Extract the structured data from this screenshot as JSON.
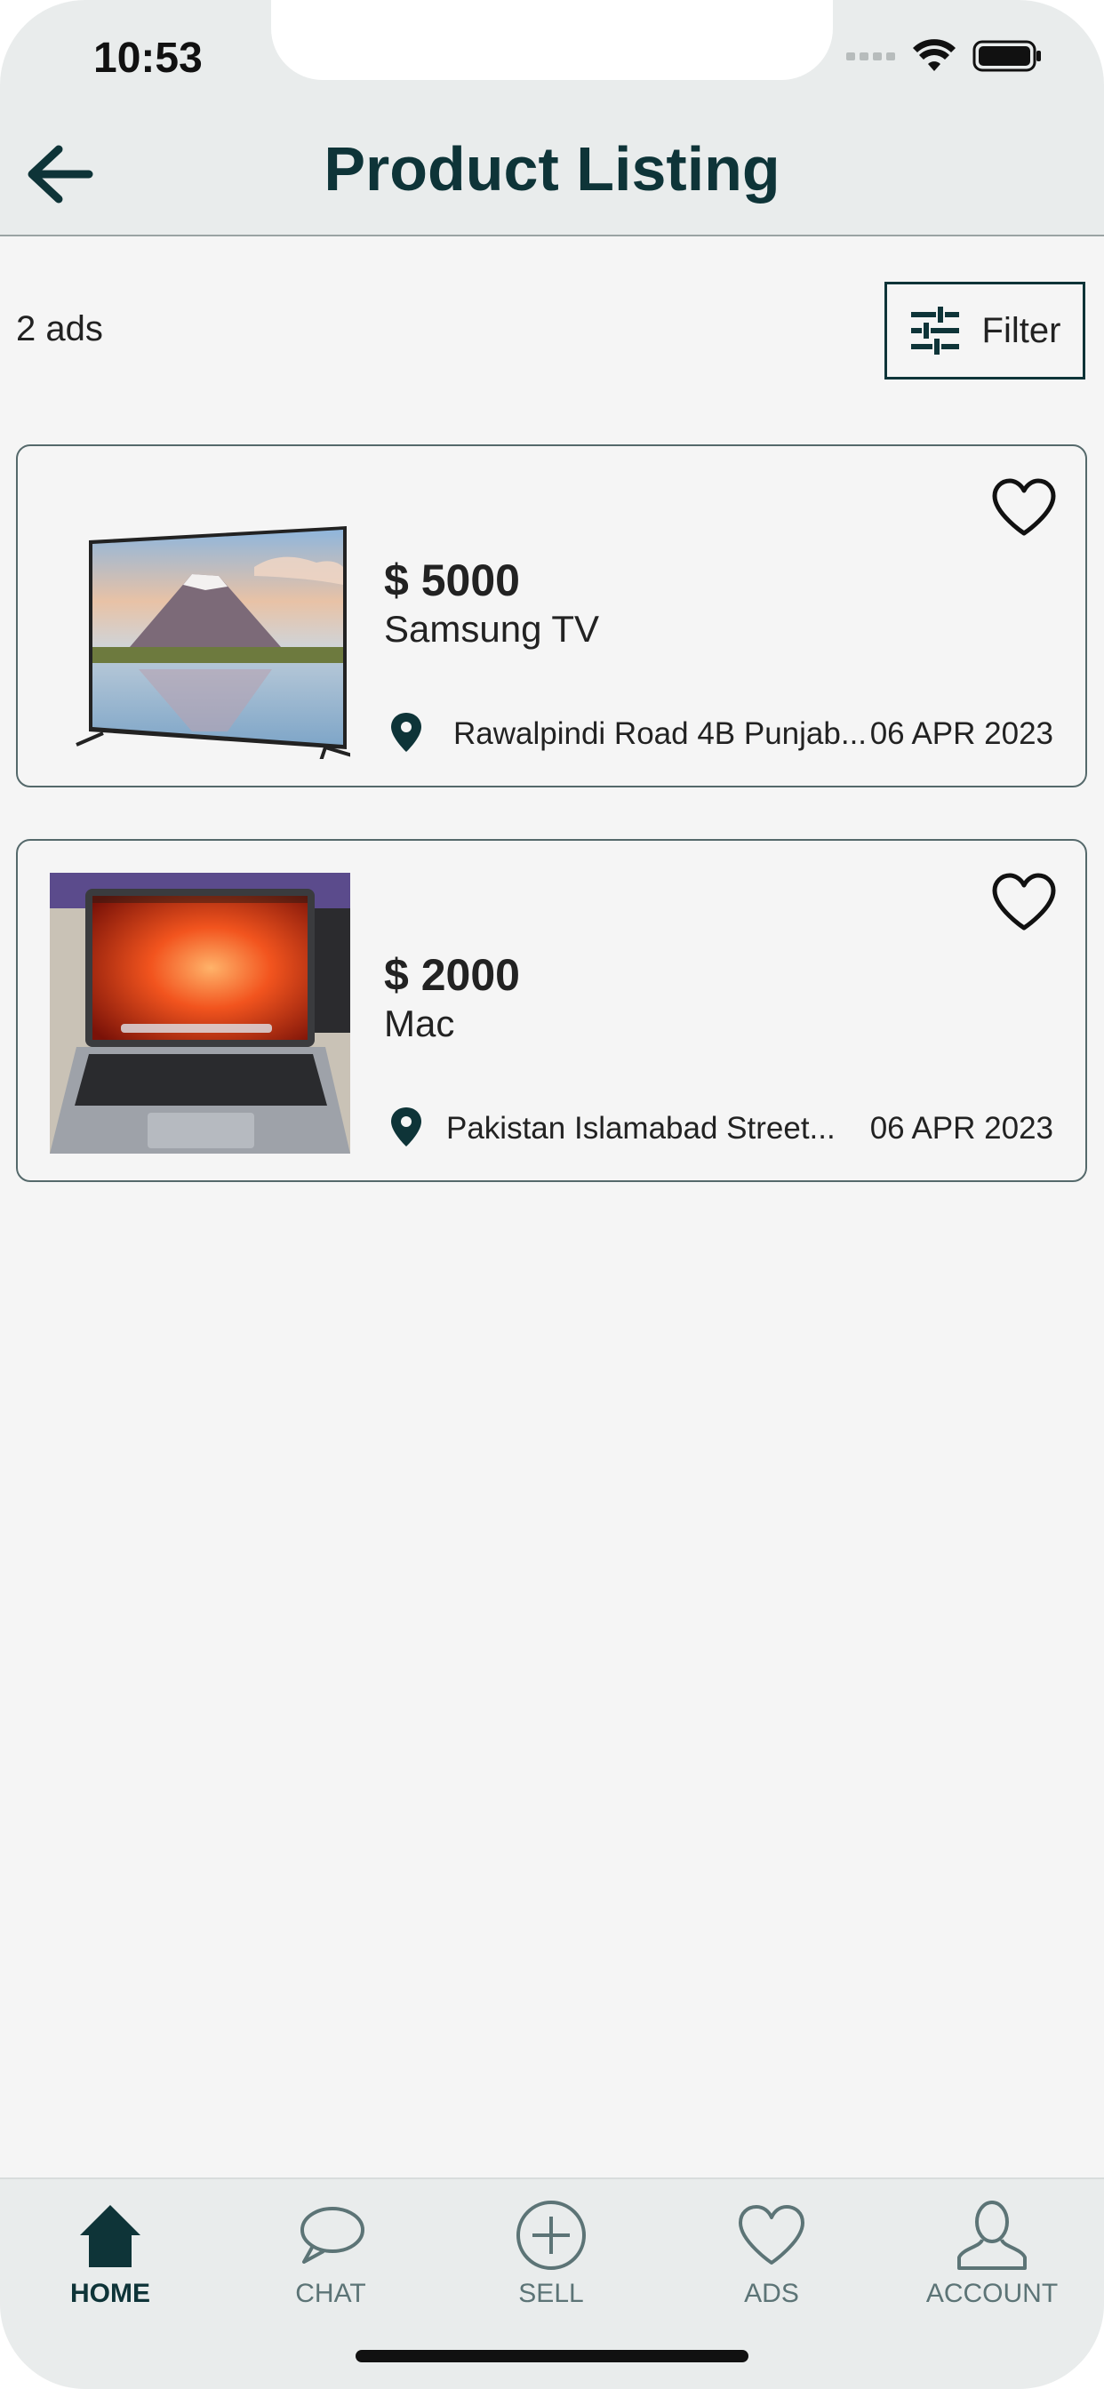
{
  "status_bar": {
    "time": "10:53"
  },
  "header": {
    "title": "Product Listing"
  },
  "listing": {
    "ads_count": "2 ads",
    "filter_label": "Filter"
  },
  "products": [
    {
      "price": "$ 5000",
      "title": "Samsung TV",
      "location": "Rawalpindi Road 4B Punjab...",
      "date": "06 APR 2023"
    },
    {
      "price": "$ 2000",
      "title": "Mac",
      "location": "Pakistan Islamabad  Street...",
      "date": "06 APR 2023"
    }
  ],
  "bottom_nav": [
    {
      "label": "HOME",
      "icon": "home-icon",
      "active": true
    },
    {
      "label": "CHAT",
      "icon": "chat-icon",
      "active": false
    },
    {
      "label": "SELL",
      "icon": "plus-circle-icon",
      "active": false
    },
    {
      "label": "ADS",
      "icon": "heart-icon",
      "active": false
    },
    {
      "label": "ACCOUNT",
      "icon": "person-icon",
      "active": false
    }
  ],
  "colors": {
    "primary": "#0e3438",
    "inactive": "#5c7476",
    "background": "#f5f5f5",
    "bar": "#e9ecec"
  }
}
